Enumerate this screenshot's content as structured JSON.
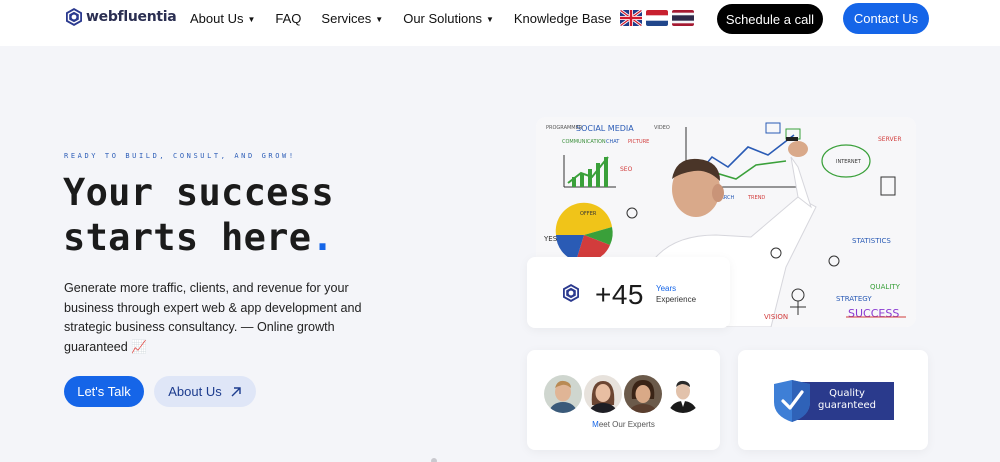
{
  "brand": {
    "name": "webfluentia"
  },
  "nav": {
    "items": [
      {
        "label": "About Us",
        "has_dropdown": true
      },
      {
        "label": "FAQ",
        "has_dropdown": false
      },
      {
        "label": "Services",
        "has_dropdown": true
      },
      {
        "label": "Our Solutions",
        "has_dropdown": true
      },
      {
        "label": "Knowledge Base",
        "has_dropdown": false
      }
    ],
    "languages": [
      "uk-flag-icon",
      "netherlands-flag-icon",
      "thailand-flag-icon"
    ],
    "schedule_label": "Schedule a call",
    "contact_label": "Contact Us"
  },
  "hero": {
    "eyebrow": "READY TO BUILD, CONSULT, AND GROW!",
    "headline_line1": "Your success",
    "headline_line2": "starts here",
    "headline_dot": ".",
    "description": "Generate more traffic, clients, and revenue for your business through expert web & app development and strategic business consultancy. — Online growth guaranteed 📈",
    "primary_cta": "Let's Talk",
    "secondary_cta": "About Us",
    "secondary_icon": "arrow-up-right-icon"
  },
  "experience": {
    "value": "+45",
    "label_line1": "Years",
    "label_line2": "Experience"
  },
  "experts": {
    "link_first": "M",
    "link_rest": "eet Our Experts",
    "count": 4
  },
  "quality": {
    "line1": "Quality",
    "line2": "guaranteed",
    "icon": "shield-check-icon"
  },
  "colors": {
    "accent": "#1565e8",
    "nav_bg": "#ffffff",
    "page_bg": "#f4f5f9",
    "dark_button": "#000000",
    "badge_navy": "#2a3a8c"
  }
}
